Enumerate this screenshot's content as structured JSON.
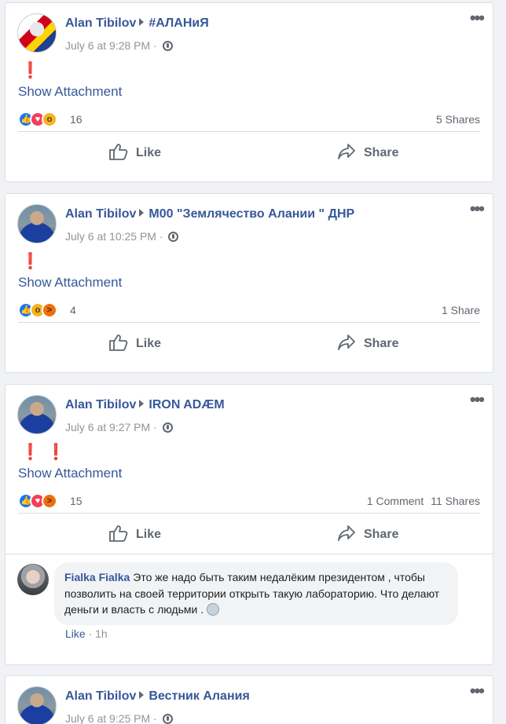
{
  "posts": [
    {
      "author": "Alan Tibilov",
      "group": "#АЛАНиЯ",
      "timestamp": "July 6 at 9:28 PM",
      "exclaims": [
        "❗"
      ],
      "attachment_label": "Show Attachment",
      "reaction_icons": [
        "like-icon",
        "love-icon",
        "wow-icon"
      ],
      "reaction_count": "16",
      "engagement": [
        "5 Shares"
      ],
      "like_label": "Like",
      "share_label": "Share"
    },
    {
      "author": "Alan Tibilov",
      "group": "M00 \"Землячество Алании \" ДНР",
      "timestamp": "July 6 at 10:25 PM",
      "exclaims": [
        "❗"
      ],
      "attachment_label": "Show Attachment",
      "reaction_icons": [
        "like-icon",
        "wow-icon",
        "angry-icon"
      ],
      "reaction_count": "4",
      "engagement": [
        "1 Share"
      ],
      "like_label": "Like",
      "share_label": "Share"
    },
    {
      "author": "Alan Tibilov",
      "group": "IRON ADÆM",
      "timestamp": "July 6 at 9:27 PM",
      "exclaims": [
        "❗",
        "❗"
      ],
      "attachment_label": "Show Attachment",
      "reaction_icons": [
        "like-icon",
        "love-icon",
        "angry-icon"
      ],
      "reaction_count": "15",
      "engagement": [
        "1 Comment",
        "11 Shares"
      ],
      "like_label": "Like",
      "share_label": "Share",
      "comment": {
        "author": "Fialka Fialka",
        "text": "Это же надо быть таким недалёким президентом , чтобы позволить на своей территории открыть такую лабораторию. Что делают деньги и власть с людьми .",
        "like_label": "Like",
        "time": "1h"
      }
    },
    {
      "author": "Alan Tibilov",
      "group": "Вестник Алания",
      "timestamp": "July 6 at 9:25 PM"
    }
  ],
  "colors": {
    "link": "#365899",
    "muted": "#606770",
    "exclaim": "#e02424",
    "like": "#1877f2",
    "love": "#f33e58",
    "wow": "#f7b125",
    "angry": "#e9710f"
  }
}
